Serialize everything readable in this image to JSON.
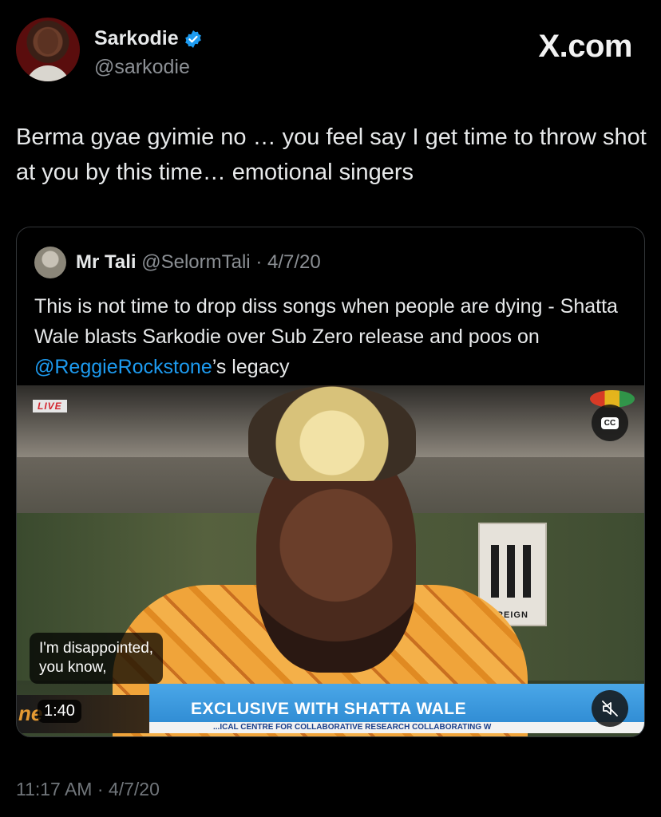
{
  "author": {
    "display_name": "Sarkodie",
    "handle": "@sarkodie",
    "verified": true
  },
  "brand": "X.com",
  "tweet": {
    "text": "Berma gyae gyimie no … you feel say I get time to throw shot at you by this time… emotional singers",
    "timestamp": "11:17 AM · 4/7/20"
  },
  "quoted_tweet": {
    "display_name": "Mr Tali",
    "handle": "@SelormTali",
    "date": "· 4/7/20",
    "text_before": "This is not time to drop diss songs when people are dying - Shatta Wale blasts Sarkodie over Sub Zero release and poos on ",
    "mention": "@ReggieRockstone",
    "text_after": "’s legacy",
    "video": {
      "live_label": "LIVE",
      "caption": "I'm disappointed,\nyou know,",
      "duration": "1:40",
      "lower_third": "EXCLUSIVE WITH SHATTA WALE",
      "ticker": "...ICAL CENTRE FOR COLLABORATIVE RESEARCH COLLABORATING W",
      "show_logo": "ne",
      "backdrop_logo": "REIGN",
      "cc_label": "CC"
    }
  },
  "colors": {
    "background": "#000000",
    "text": "#e7e9ea",
    "secondary": "#71767b",
    "link": "#1d9bf0",
    "verified": "#1d9bf0"
  },
  "icons": [
    "verified-badge-icon",
    "closed-captions-icon",
    "mute-icon"
  ]
}
